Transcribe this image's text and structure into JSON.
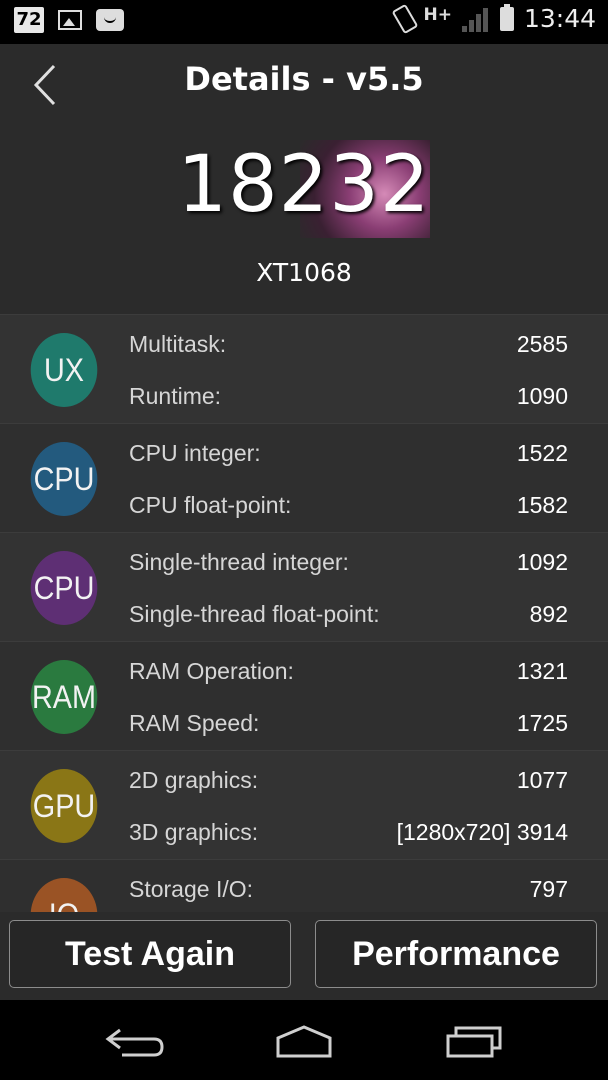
{
  "status_bar": {
    "badge": "72",
    "network": "H+",
    "time": "13:44",
    "icons": [
      "badge-72-icon",
      "image-icon",
      "message-icon",
      "rotate-icon",
      "signal-icon",
      "battery-icon"
    ]
  },
  "header": {
    "title": "Details - v5.5",
    "score": "18232",
    "device": "XT1068"
  },
  "categories": [
    {
      "icon": "UX",
      "color": "#1f7a6c",
      "items": [
        {
          "label": "Multitask:",
          "value": "2585"
        },
        {
          "label": "Runtime:",
          "value": "1090"
        }
      ]
    },
    {
      "icon": "CPU",
      "color": "#235a7e",
      "items": [
        {
          "label": "CPU integer:",
          "value": "1522"
        },
        {
          "label": "CPU float-point:",
          "value": "1582"
        }
      ]
    },
    {
      "icon": "CPU",
      "color": "#5e2f74",
      "items": [
        {
          "label": "Single-thread integer:",
          "value": "1092"
        },
        {
          "label": "Single-thread float-point:",
          "value": "892"
        }
      ]
    },
    {
      "icon": "RAM",
      "color": "#2a7a3f",
      "items": [
        {
          "label": "RAM Operation:",
          "value": "1321"
        },
        {
          "label": "RAM Speed:",
          "value": "1725"
        }
      ]
    },
    {
      "icon": "GPU",
      "color": "#8a7616",
      "items": [
        {
          "label": "2D graphics:",
          "value": "1077"
        },
        {
          "label": "3D graphics:",
          "value": "[1280x720] 3914"
        }
      ]
    },
    {
      "icon": "IO",
      "color": "#9a5325",
      "items": [
        {
          "label": "Storage I/O:",
          "value": "797"
        },
        {
          "label": "",
          "value": ""
        }
      ]
    }
  ],
  "buttons": {
    "test_again": "Test Again",
    "performance": "Performance"
  },
  "navbar": {
    "icons": [
      "back-nav-icon",
      "home-nav-icon",
      "recents-nav-icon"
    ]
  }
}
